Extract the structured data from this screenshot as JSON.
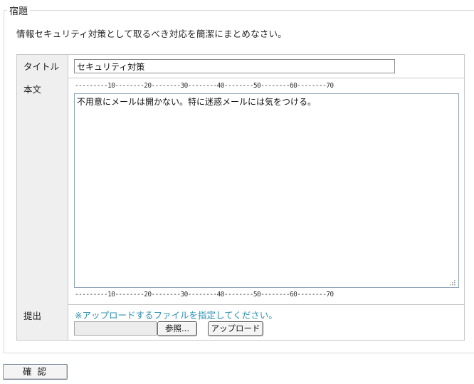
{
  "section": {
    "legend": "宿題"
  },
  "instruction": "情報セキュリティ対策として取るべき対応を簡潔にまとめなさい。",
  "form": {
    "title_label": "タイトル",
    "title_value": "セキュリティ対策",
    "body_label": "本文",
    "ruler": "---------10--------20--------30--------40--------50--------60--------70",
    "body_value": "不用意にメールは開かない。特に迷惑メールには気をつける。",
    "submit_label": "提出",
    "upload_note": "※アップロードするファイルを指定してください。",
    "browse_label": "参照...",
    "upload_label": "アップロード"
  },
  "confirm_label": "確認",
  "icons": {
    "resize": "resize-grip-icon"
  },
  "colors": {
    "note": "#2a8fb0",
    "header_bg": "#efefef",
    "border": "#c8c8c8"
  }
}
